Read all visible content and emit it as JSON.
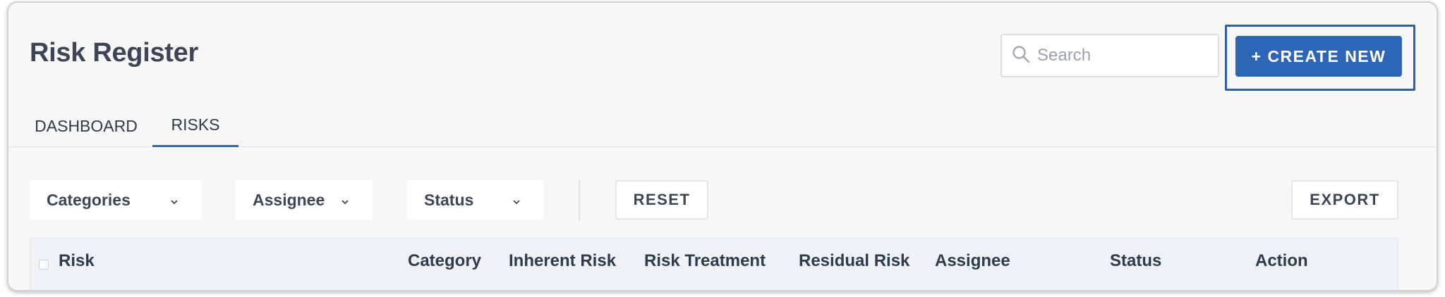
{
  "header": {
    "title": "Risk Register",
    "search_placeholder": "Search",
    "create_label": "+ CREATE NEW"
  },
  "tabs": [
    {
      "label": "DASHBOARD",
      "active": false
    },
    {
      "label": "RISKS",
      "active": true
    }
  ],
  "filters": {
    "categories_label": "Categories",
    "assignee_label": "Assignee",
    "status_label": "Status",
    "reset_label": "RESET",
    "export_label": "EXPORT"
  },
  "table": {
    "columns": [
      "Risk",
      "Category",
      "Inherent Risk",
      "Risk Treatment",
      "Residual Risk",
      "Assignee",
      "Status",
      "Action"
    ]
  },
  "icons": {
    "search": "search-icon",
    "chevron": "chevron-down-icon"
  },
  "colors": {
    "accent": "#2e66b5",
    "highlight_border": "#2f5eaa",
    "background": "#f7f7f7"
  }
}
